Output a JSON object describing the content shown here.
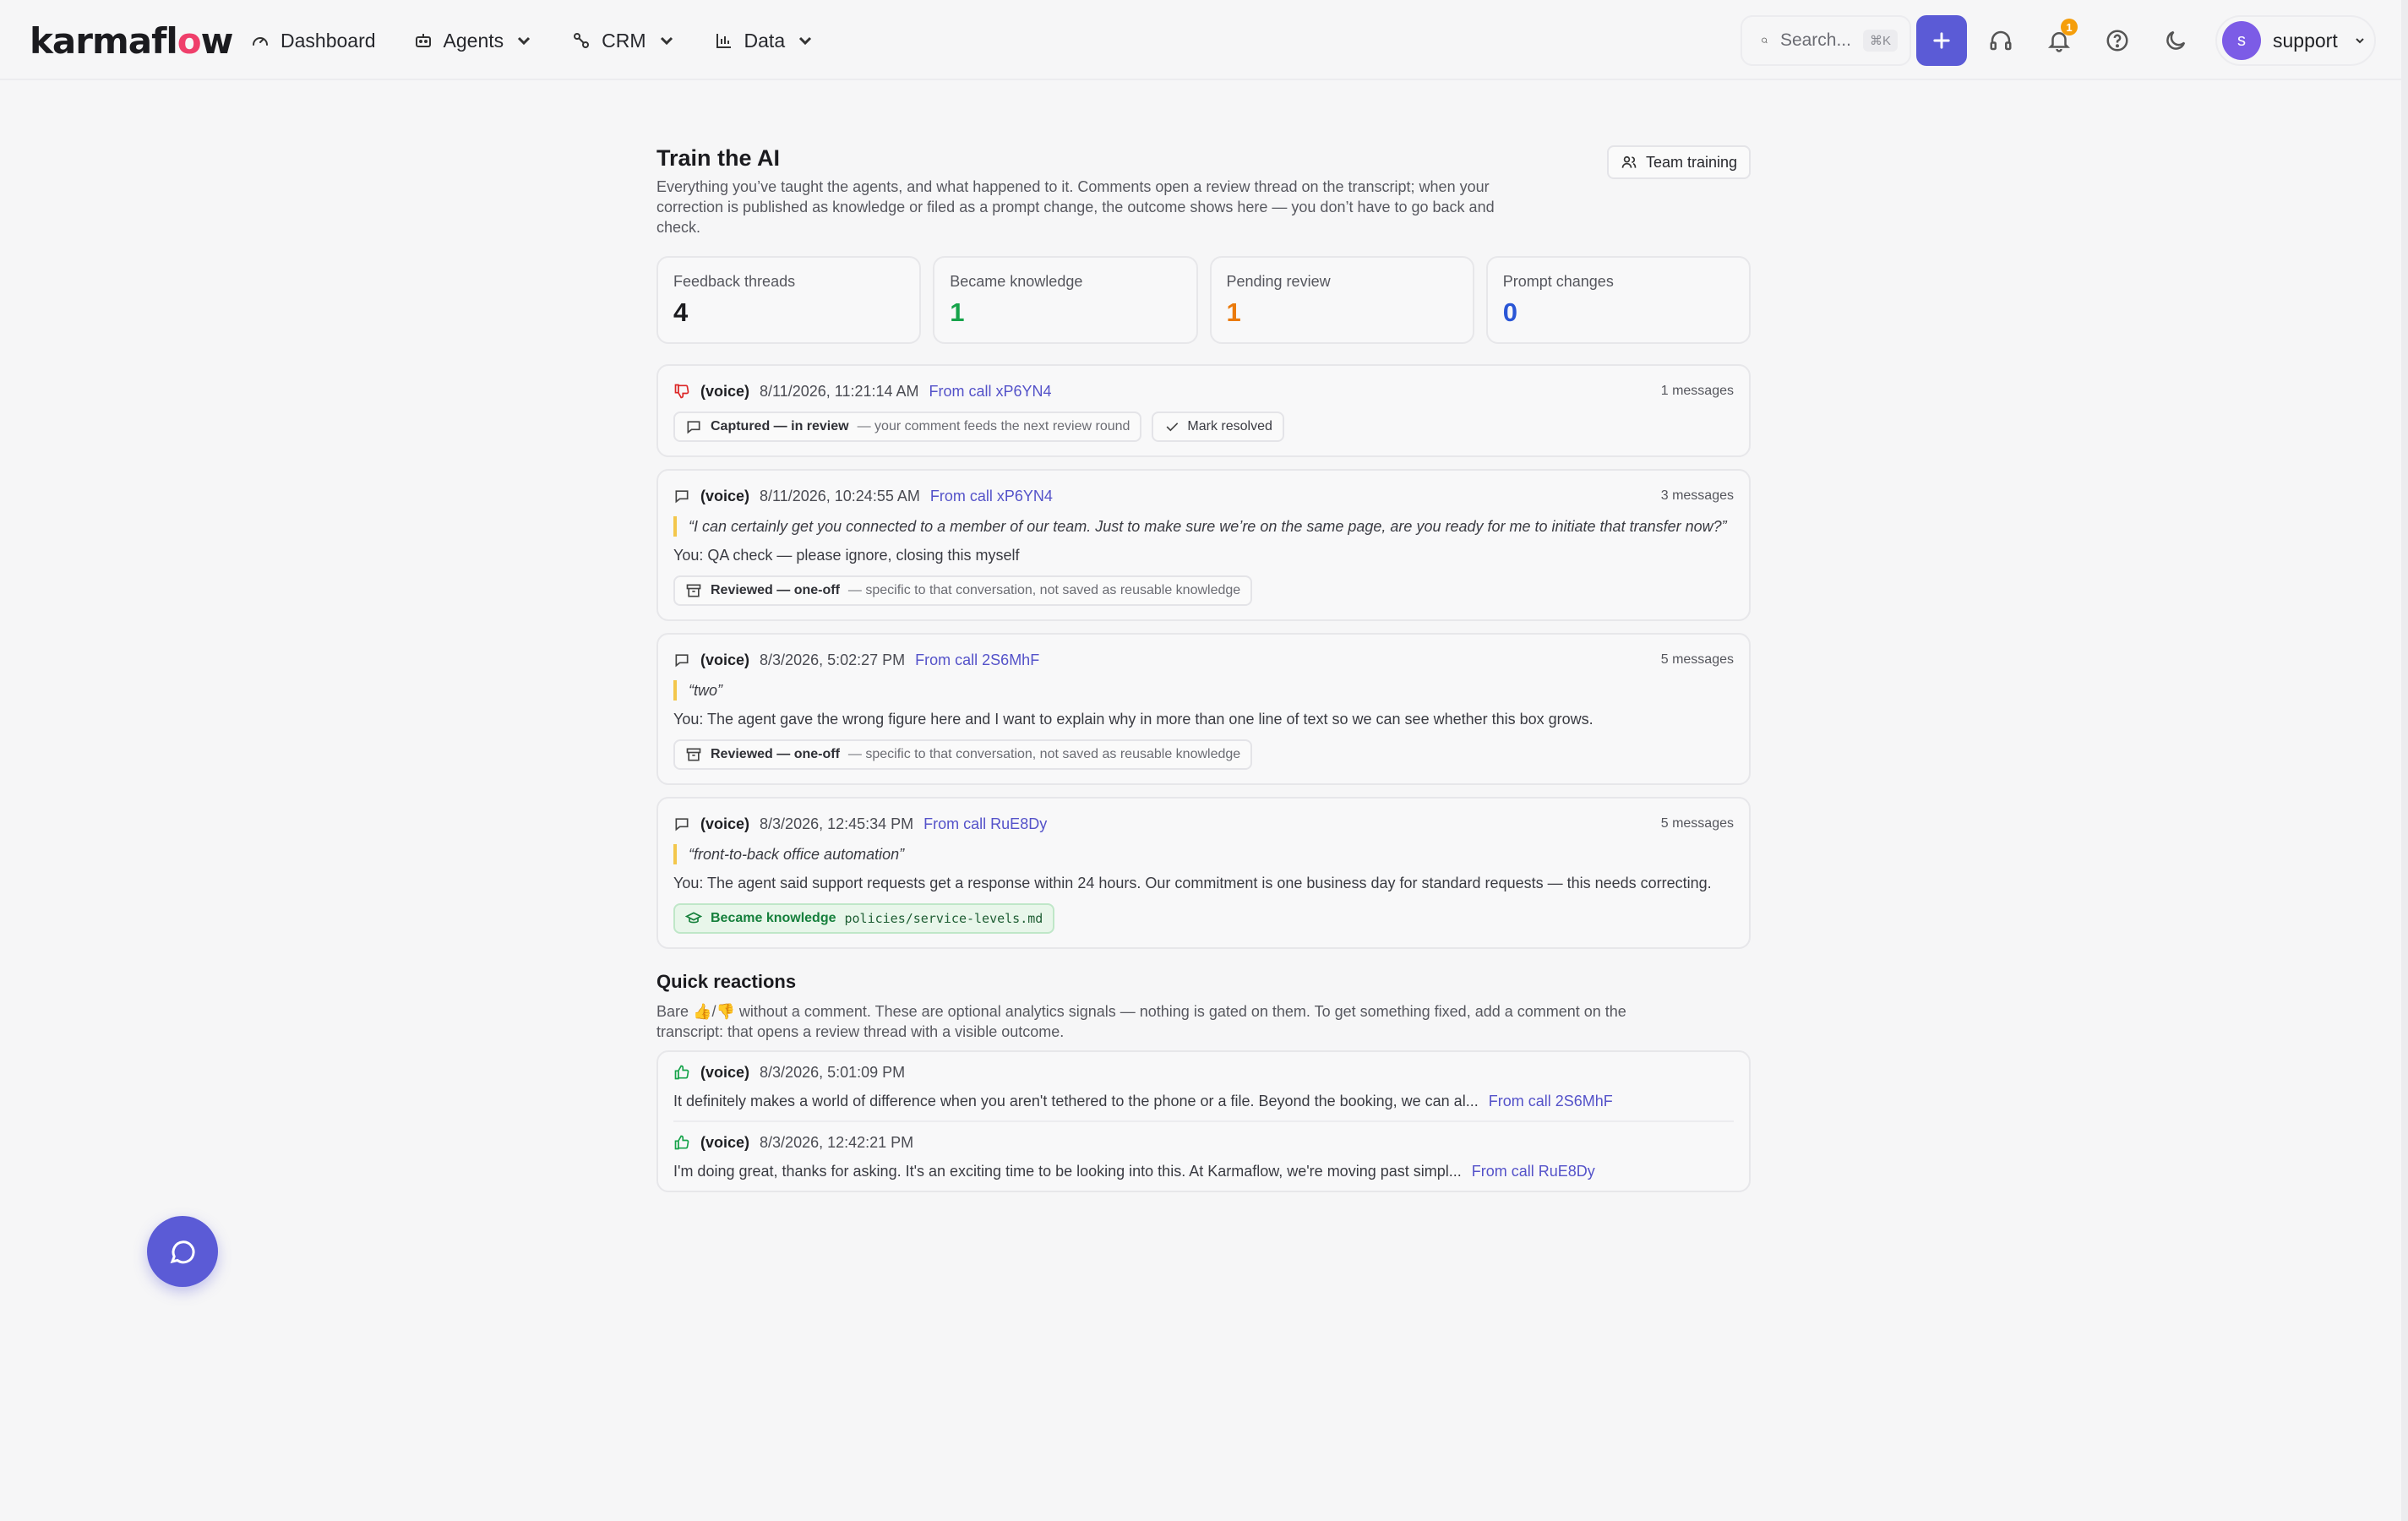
{
  "brand": {
    "name_pre": "karmafl",
    "name_flame": "o",
    "name_post": "w",
    "accent": "#5b5bd6",
    "flame_color": "#ef3f6b"
  },
  "nav": {
    "items": [
      {
        "label": "Dashboard",
        "icon": "gauge-icon"
      },
      {
        "label": "Agents",
        "icon": "robot-icon"
      },
      {
        "label": "CRM",
        "icon": "crm-icon"
      },
      {
        "label": "Data",
        "icon": "bar-chart-icon"
      }
    ],
    "search_placeholder": "Search...",
    "search_shortcut": "⌘K",
    "notification_count": "1",
    "user": {
      "initial": "s",
      "name": "support"
    }
  },
  "page": {
    "title": "Train the AI",
    "team_training_label": "Team training",
    "description": "Everything you’ve taught the agents, and what happened to it. Comments open a review thread on the transcript; when your correction is published as knowledge or filed as a prompt change, the outcome shows here — you don’t have to go back and check."
  },
  "stats": [
    {
      "label": "Feedback threads",
      "value": "4",
      "color": "#1b1b1f"
    },
    {
      "label": "Became knowledge",
      "value": "1",
      "color": "#16a34a"
    },
    {
      "label": "Pending review",
      "value": "1",
      "color": "#ea7a0c"
    },
    {
      "label": "Prompt changes",
      "value": "0",
      "color": "#2a56d6"
    }
  ],
  "threads": [
    {
      "icon": "thumbs-down-icon",
      "channel": "(voice)",
      "date": "8/11/2026, 11:21:14 AM",
      "link": "From call xP6YN4",
      "messages": "1 messages",
      "outcome_bold": "Captured — in review",
      "outcome_sub": "— your comment feeds the next review round",
      "action": "Mark resolved"
    },
    {
      "icon": "comment-icon",
      "channel": "(voice)",
      "date": "8/11/2026, 10:24:55 AM",
      "link": "From call xP6YN4",
      "messages": "3 messages",
      "quote": "“I can certainly get you connected to a member of our team. Just to make sure we’re on the same page, are you ready for me to initiate that transfer now?”",
      "you": "You: QA check — please ignore, closing this myself",
      "outcome_bold": "Reviewed — one-off",
      "outcome_sub": "— specific to that conversation, not saved as reusable knowledge"
    },
    {
      "icon": "comment-icon",
      "channel": "(voice)",
      "date": "8/3/2026, 5:02:27 PM",
      "link": "From call 2S6MhF",
      "messages": "5 messages",
      "quote": "“two”",
      "you": "You: The agent gave the wrong figure here and I want to explain why in more than one line of text so we can see whether this box grows.",
      "outcome_bold": "Reviewed — one-off",
      "outcome_sub": "— specific to that conversation, not saved as reusable knowledge"
    },
    {
      "icon": "comment-icon",
      "channel": "(voice)",
      "date": "8/3/2026, 12:45:34 PM",
      "link": "From call RuE8Dy",
      "messages": "5 messages",
      "quote": "“front-to-back office automation”",
      "you": "You: The agent said support requests get a response within 24 hours. Our commitment is one business day for standard requests — this needs correcting.",
      "outcome_bold": "Became knowledge",
      "outcome_code": "policies/service-levels.md"
    }
  ],
  "quick_reactions": {
    "title": "Quick reactions",
    "desc_pre": "Bare ",
    "desc_emoji": "👍/👎",
    "desc_post": " without a comment. These are optional analytics signals — nothing is gated on them. To get something fixed, add a comment on the transcript: that opens a review thread with a visible outcome.",
    "items": [
      {
        "channel": "(voice)",
        "date": "8/3/2026, 5:01:09 PM",
        "text": "It definitely makes a world of difference when you aren't tethered to the phone or a file. Beyond the booking, we can al...",
        "link": "From call 2S6MhF"
      },
      {
        "channel": "(voice)",
        "date": "8/3/2026, 12:42:21 PM",
        "text": "I'm doing great, thanks for asking. It's an exciting time to be looking into this. At Karmaflow, we're moving past simpl...",
        "link": "From call RuE8Dy"
      }
    ]
  }
}
